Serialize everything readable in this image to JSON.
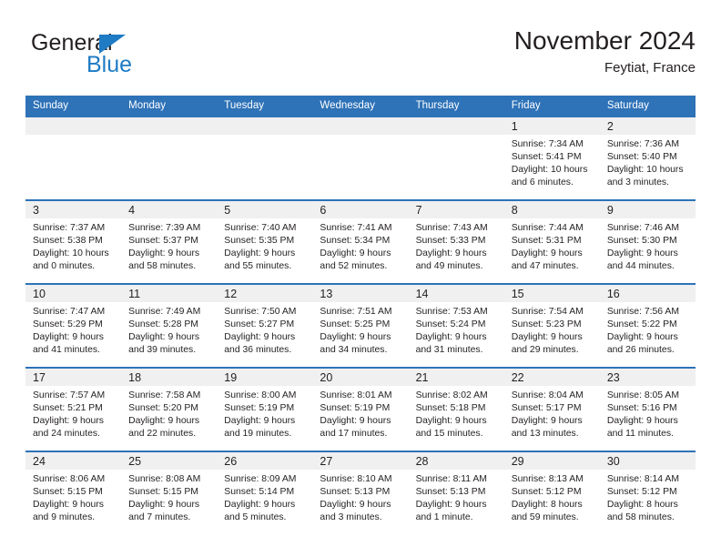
{
  "brand": {
    "name_top": "General",
    "name_bottom": "Blue",
    "triangle_color": "#1e7bc4"
  },
  "header": {
    "title": "November 2024",
    "subtitle": "Feytiat, France",
    "accent_color": "#2e72b8"
  },
  "weekday_headers": [
    "Sunday",
    "Monday",
    "Tuesday",
    "Wednesday",
    "Thursday",
    "Friday",
    "Saturday"
  ],
  "labels": {
    "sunrise": "Sunrise:",
    "sunset": "Sunset:",
    "daylight": "Daylight:"
  },
  "weeks": [
    [
      {
        "empty": true
      },
      {
        "empty": true
      },
      {
        "empty": true
      },
      {
        "empty": true
      },
      {
        "empty": true
      },
      {
        "day": "1",
        "sunrise": "Sunrise: 7:34 AM",
        "sunset": "Sunset: 5:41 PM",
        "daylight_line1": "Daylight: 10 hours",
        "daylight_line2": "and 6 minutes."
      },
      {
        "day": "2",
        "sunrise": "Sunrise: 7:36 AM",
        "sunset": "Sunset: 5:40 PM",
        "daylight_line1": "Daylight: 10 hours",
        "daylight_line2": "and 3 minutes."
      }
    ],
    [
      {
        "day": "3",
        "sunrise": "Sunrise: 7:37 AM",
        "sunset": "Sunset: 5:38 PM",
        "daylight_line1": "Daylight: 10 hours",
        "daylight_line2": "and 0 minutes."
      },
      {
        "day": "4",
        "sunrise": "Sunrise: 7:39 AM",
        "sunset": "Sunset: 5:37 PM",
        "daylight_line1": "Daylight: 9 hours",
        "daylight_line2": "and 58 minutes."
      },
      {
        "day": "5",
        "sunrise": "Sunrise: 7:40 AM",
        "sunset": "Sunset: 5:35 PM",
        "daylight_line1": "Daylight: 9 hours",
        "daylight_line2": "and 55 minutes."
      },
      {
        "day": "6",
        "sunrise": "Sunrise: 7:41 AM",
        "sunset": "Sunset: 5:34 PM",
        "daylight_line1": "Daylight: 9 hours",
        "daylight_line2": "and 52 minutes."
      },
      {
        "day": "7",
        "sunrise": "Sunrise: 7:43 AM",
        "sunset": "Sunset: 5:33 PM",
        "daylight_line1": "Daylight: 9 hours",
        "daylight_line2": "and 49 minutes."
      },
      {
        "day": "8",
        "sunrise": "Sunrise: 7:44 AM",
        "sunset": "Sunset: 5:31 PM",
        "daylight_line1": "Daylight: 9 hours",
        "daylight_line2": "and 47 minutes."
      },
      {
        "day": "9",
        "sunrise": "Sunrise: 7:46 AM",
        "sunset": "Sunset: 5:30 PM",
        "daylight_line1": "Daylight: 9 hours",
        "daylight_line2": "and 44 minutes."
      }
    ],
    [
      {
        "day": "10",
        "sunrise": "Sunrise: 7:47 AM",
        "sunset": "Sunset: 5:29 PM",
        "daylight_line1": "Daylight: 9 hours",
        "daylight_line2": "and 41 minutes."
      },
      {
        "day": "11",
        "sunrise": "Sunrise: 7:49 AM",
        "sunset": "Sunset: 5:28 PM",
        "daylight_line1": "Daylight: 9 hours",
        "daylight_line2": "and 39 minutes."
      },
      {
        "day": "12",
        "sunrise": "Sunrise: 7:50 AM",
        "sunset": "Sunset: 5:27 PM",
        "daylight_line1": "Daylight: 9 hours",
        "daylight_line2": "and 36 minutes."
      },
      {
        "day": "13",
        "sunrise": "Sunrise: 7:51 AM",
        "sunset": "Sunset: 5:25 PM",
        "daylight_line1": "Daylight: 9 hours",
        "daylight_line2": "and 34 minutes."
      },
      {
        "day": "14",
        "sunrise": "Sunrise: 7:53 AM",
        "sunset": "Sunset: 5:24 PM",
        "daylight_line1": "Daylight: 9 hours",
        "daylight_line2": "and 31 minutes."
      },
      {
        "day": "15",
        "sunrise": "Sunrise: 7:54 AM",
        "sunset": "Sunset: 5:23 PM",
        "daylight_line1": "Daylight: 9 hours",
        "daylight_line2": "and 29 minutes."
      },
      {
        "day": "16",
        "sunrise": "Sunrise: 7:56 AM",
        "sunset": "Sunset: 5:22 PM",
        "daylight_line1": "Daylight: 9 hours",
        "daylight_line2": "and 26 minutes."
      }
    ],
    [
      {
        "day": "17",
        "sunrise": "Sunrise: 7:57 AM",
        "sunset": "Sunset: 5:21 PM",
        "daylight_line1": "Daylight: 9 hours",
        "daylight_line2": "and 24 minutes."
      },
      {
        "day": "18",
        "sunrise": "Sunrise: 7:58 AM",
        "sunset": "Sunset: 5:20 PM",
        "daylight_line1": "Daylight: 9 hours",
        "daylight_line2": "and 22 minutes."
      },
      {
        "day": "19",
        "sunrise": "Sunrise: 8:00 AM",
        "sunset": "Sunset: 5:19 PM",
        "daylight_line1": "Daylight: 9 hours",
        "daylight_line2": "and 19 minutes."
      },
      {
        "day": "20",
        "sunrise": "Sunrise: 8:01 AM",
        "sunset": "Sunset: 5:19 PM",
        "daylight_line1": "Daylight: 9 hours",
        "daylight_line2": "and 17 minutes."
      },
      {
        "day": "21",
        "sunrise": "Sunrise: 8:02 AM",
        "sunset": "Sunset: 5:18 PM",
        "daylight_line1": "Daylight: 9 hours",
        "daylight_line2": "and 15 minutes."
      },
      {
        "day": "22",
        "sunrise": "Sunrise: 8:04 AM",
        "sunset": "Sunset: 5:17 PM",
        "daylight_line1": "Daylight: 9 hours",
        "daylight_line2": "and 13 minutes."
      },
      {
        "day": "23",
        "sunrise": "Sunrise: 8:05 AM",
        "sunset": "Sunset: 5:16 PM",
        "daylight_line1": "Daylight: 9 hours",
        "daylight_line2": "and 11 minutes."
      }
    ],
    [
      {
        "day": "24",
        "sunrise": "Sunrise: 8:06 AM",
        "sunset": "Sunset: 5:15 PM",
        "daylight_line1": "Daylight: 9 hours",
        "daylight_line2": "and 9 minutes."
      },
      {
        "day": "25",
        "sunrise": "Sunrise: 8:08 AM",
        "sunset": "Sunset: 5:15 PM",
        "daylight_line1": "Daylight: 9 hours",
        "daylight_line2": "and 7 minutes."
      },
      {
        "day": "26",
        "sunrise": "Sunrise: 8:09 AM",
        "sunset": "Sunset: 5:14 PM",
        "daylight_line1": "Daylight: 9 hours",
        "daylight_line2": "and 5 minutes."
      },
      {
        "day": "27",
        "sunrise": "Sunrise: 8:10 AM",
        "sunset": "Sunset: 5:13 PM",
        "daylight_line1": "Daylight: 9 hours",
        "daylight_line2": "and 3 minutes."
      },
      {
        "day": "28",
        "sunrise": "Sunrise: 8:11 AM",
        "sunset": "Sunset: 5:13 PM",
        "daylight_line1": "Daylight: 9 hours",
        "daylight_line2": "and 1 minute."
      },
      {
        "day": "29",
        "sunrise": "Sunrise: 8:13 AM",
        "sunset": "Sunset: 5:12 PM",
        "daylight_line1": "Daylight: 8 hours",
        "daylight_line2": "and 59 minutes."
      },
      {
        "day": "30",
        "sunrise": "Sunrise: 8:14 AM",
        "sunset": "Sunset: 5:12 PM",
        "daylight_line1": "Daylight: 8 hours",
        "daylight_line2": "and 58 minutes."
      }
    ]
  ]
}
